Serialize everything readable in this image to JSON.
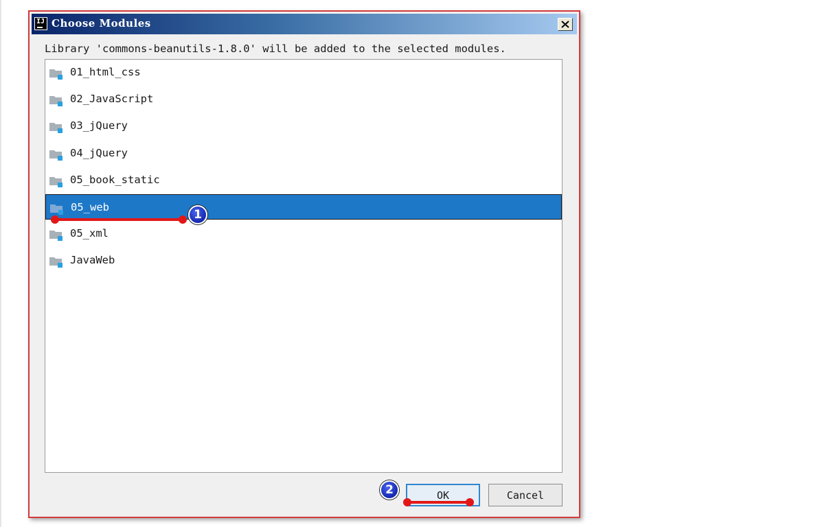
{
  "dialog": {
    "title": "Choose Modules",
    "app_icon_text": "IJ",
    "message": "Library 'commons-beanutils-1.8.0' will be added to the selected modules."
  },
  "modules": [
    {
      "label": "01_html_css",
      "selected": false
    },
    {
      "label": "02_JavaScript",
      "selected": false
    },
    {
      "label": "03_jQuery",
      "selected": false
    },
    {
      "label": "04_jQuery",
      "selected": false
    },
    {
      "label": "05_book_static",
      "selected": false
    },
    {
      "label": "05_web",
      "selected": true
    },
    {
      "label": "05_xml",
      "selected": false
    },
    {
      "label": "JavaWeb",
      "selected": false
    }
  ],
  "buttons": {
    "ok_label": "OK",
    "cancel_label": "Cancel"
  },
  "annotations": {
    "step1_number": "1",
    "step2_number": "2"
  },
  "icons": {
    "close": "close-icon",
    "folder": "module-folder-icon"
  },
  "colors": {
    "selection": "#1e78c8",
    "annotation_line": "#e21818",
    "annotation_marker": "#1428b0",
    "dialog_border": "#d23a3a"
  }
}
